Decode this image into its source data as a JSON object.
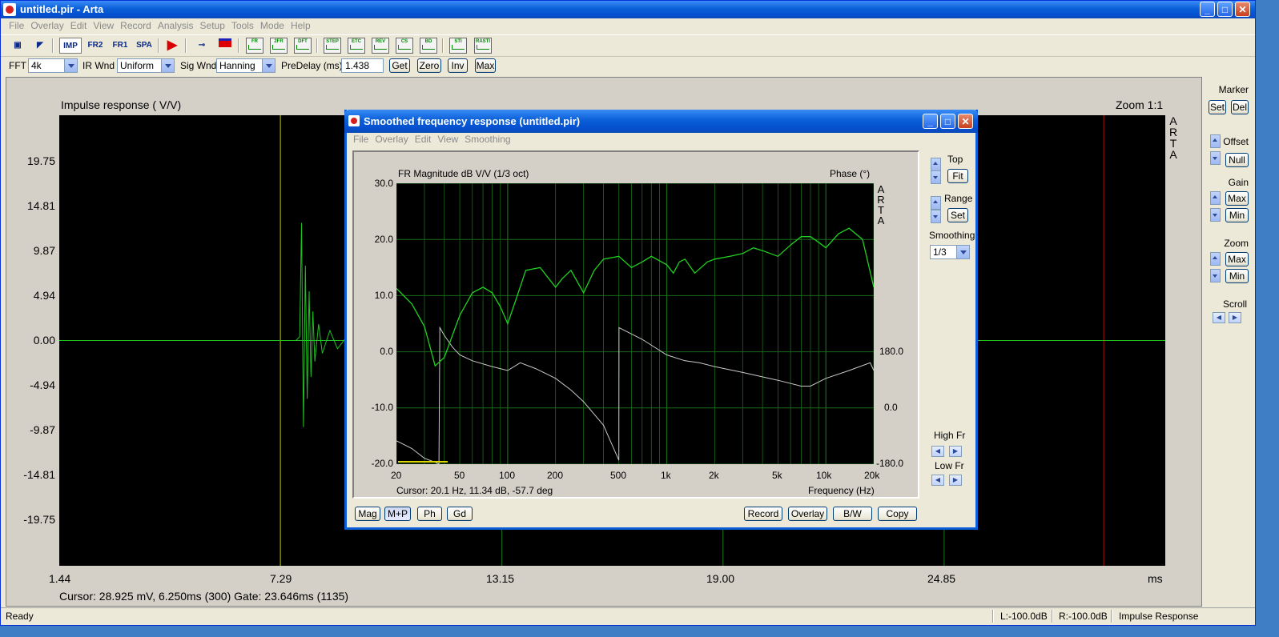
{
  "window": {
    "title": "untitled.pir - Arta",
    "min": "_",
    "max": "□",
    "close": "✕"
  },
  "menu": [
    "File",
    "Overlay",
    "Edit",
    "View",
    "Record",
    "Analysis",
    "Setup",
    "Tools",
    "Mode",
    "Help"
  ],
  "toolbar": {
    "imp": "IMP",
    "fr2": "FR2",
    "fr1": "FR1",
    "spa": "SPA",
    "plot_buttons": [
      "FR",
      "2FR",
      "DFT",
      "STEP",
      "ETC",
      "REV",
      "CS",
      "BD",
      "STI",
      "RASTI"
    ]
  },
  "options": {
    "fft_label": "FFT",
    "fft_value": "4k",
    "irwnd_label": "IR Wnd",
    "irwnd_value": "Uniform",
    "sigwnd_label": "Sig Wnd",
    "sigwnd_value": "Hanning",
    "predelay_label": "PreDelay (ms)",
    "predelay_value": "1.438",
    "buttons": [
      "Get",
      "Zero",
      "Inv",
      "Max"
    ]
  },
  "impulse": {
    "title": "Impulse response ( V/V)",
    "zoom": "Zoom 1:1",
    "arta": [
      "A",
      "R",
      "T",
      "A"
    ],
    "y_ticks": [
      "19.75",
      "14.81",
      "9.87",
      "4.94",
      "0.00",
      "-4.94",
      "-9.87",
      "-14.81",
      "-19.75"
    ],
    "x_ticks": [
      "1.44",
      "7.29",
      "13.15",
      "19.00",
      "24.85"
    ],
    "x_unit": "ms",
    "cursor": "Cursor: 28.925 mV, 6.250ms (300)  Gate: 23.646ms (1135)",
    "colors": {
      "zero_line": "#c00000",
      "marker_start": "#b8b800",
      "marker_gate": "#c00000",
      "grid": "#1a7a1a",
      "trace": "#20c020"
    }
  },
  "right_panel": {
    "marker": "Marker",
    "set": "Set",
    "del": "Del",
    "offset": "Offset",
    "null": "Null",
    "gain": "Gain",
    "gain_max": "Max",
    "gain_min": "Min",
    "zoom": "Zoom",
    "zoom_max": "Max",
    "zoom_min": "Min",
    "scroll": "Scroll"
  },
  "status": {
    "ready": "Ready",
    "left": "L:-100.0dB",
    "right": "R:-100.0dB",
    "mode": "Impulse Response"
  },
  "freq_window": {
    "title": "Smoothed frequency response (untitled.pir)",
    "menu": [
      "File",
      "Overlay",
      "Edit",
      "View",
      "Smoothing"
    ],
    "plot_title": "FR Magnitude dB V/V (1/3 oct)",
    "phase_label": "Phase (°)",
    "arta": [
      "A",
      "R",
      "T",
      "A"
    ],
    "y_ticks": [
      "30.0",
      "20.0",
      "10.0",
      "0.0",
      "-10.0",
      "-20.0"
    ],
    "phase_ticks": [
      "180.0",
      "0.0",
      "-180.0"
    ],
    "x_ticks": [
      "20",
      "50",
      "100",
      "200",
      "500",
      "1k",
      "2k",
      "5k",
      "10k",
      "20k"
    ],
    "x_label": "Frequency (Hz)",
    "cursor": "Cursor: 20.1 Hz, 11.34 dB, -57.7 deg",
    "top_label": "Top",
    "fit": "Fit",
    "range_label": "Range",
    "set": "Set",
    "smoothing_label": "Smoothing",
    "smoothing_value": "1/3",
    "high_fr": "High Fr",
    "low_fr": "Low Fr",
    "bottom_left": [
      "Mag",
      "M+P",
      "Ph",
      "Gd"
    ],
    "bottom_right": [
      "Record",
      "Overlay",
      "B/W",
      "Copy"
    ]
  },
  "chart_data": [
    {
      "type": "line",
      "title": "Impulse response ( V/V)",
      "xlabel": "ms",
      "ylabel": "",
      "xlim": [
        1.44,
        30.7
      ],
      "ylim": [
        -24.7,
        24.7
      ],
      "grid": true,
      "series": [
        {
          "x": [
            1.44,
            7.29,
            7.7,
            7.8,
            7.85,
            7.9,
            7.95,
            8.0,
            8.05,
            8.1,
            8.15,
            8.2,
            8.3,
            8.4,
            8.6,
            8.8,
            9.1,
            9.5,
            10.1,
            10.8,
            30.7
          ],
          "values": [
            0,
            0,
            0,
            0.4,
            12.9,
            -9.5,
            8.2,
            -6.4,
            5.4,
            -4.0,
            3.2,
            -2.3,
            1.8,
            -1.4,
            1.1,
            -0.9,
            0.7,
            -0.5,
            0.3,
            0,
            0
          ]
        }
      ]
    },
    {
      "type": "line",
      "title": "FR Magnitude dB V/V (1/3 oct)",
      "xlabel": "Frequency (Hz)",
      "ylabel": "",
      "log_x": true,
      "xlim": [
        20,
        20000
      ],
      "ylim": [
        -20,
        30
      ],
      "y2lim": [
        -180,
        180
      ],
      "grid": true,
      "series": [
        {
          "x": [
            20,
            25,
            30,
            35,
            40,
            50,
            60,
            70,
            80,
            90,
            100,
            115,
            130,
            160,
            200,
            220,
            250,
            300,
            350,
            400,
            500,
            600,
            700,
            800,
            1000,
            1100,
            1200,
            1300,
            1500,
            1800,
            2000,
            2500,
            3000,
            3500,
            4000,
            5000,
            6000,
            7000,
            8000,
            9000,
            10000,
            12000,
            14000,
            17000,
            20000
          ],
          "values": [
            11.3,
            8.5,
            4.5,
            -2.5,
            -1.0,
            6.5,
            10.5,
            11.5,
            10.5,
            8.0,
            5.0,
            10.0,
            14.5,
            15.0,
            11.5,
            13.0,
            14.5,
            10.5,
            14.5,
            16.5,
            17.0,
            15.0,
            16.0,
            17.0,
            15.5,
            14.0,
            16.0,
            16.5,
            14.0,
            16.0,
            16.5,
            17.0,
            17.5,
            18.5,
            18.0,
            17.0,
            19.0,
            20.5,
            20.5,
            19.5,
            18.5,
            21.0,
            22.0,
            20.0,
            11.5
          ]
        },
        {
          "x": [
            20,
            25,
            30,
            35,
            37,
            37.5,
            40,
            45,
            50,
            60,
            80,
            100,
            120,
            150,
            200,
            250,
            300,
            400,
            500,
            501,
            700,
            1000,
            1300,
            1600,
            2000,
            3000,
            5000,
            7000,
            8000,
            10000,
            14000,
            19000,
            20000
          ],
          "values": [
            -120,
            -140,
            -165,
            -175,
            -180,
            170,
            150,
            120,
            100,
            85,
            70,
            60,
            80,
            65,
            40,
            10,
            -20,
            -80,
            -170,
            170,
            140,
            100,
            85,
            80,
            70,
            55,
            35,
            20,
            20,
            40,
            60,
            80,
            60
          ]
        }
      ]
    }
  ]
}
